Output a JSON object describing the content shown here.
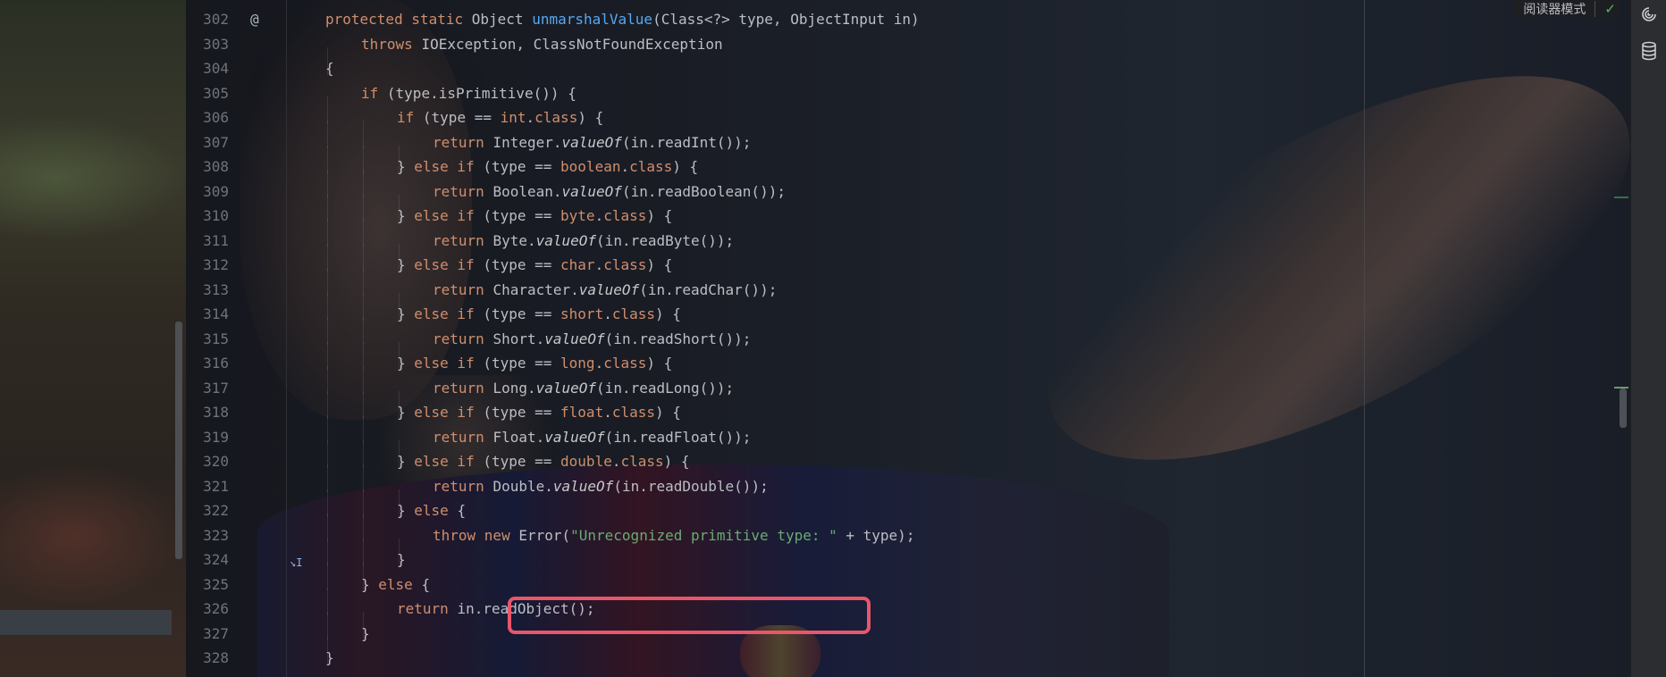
{
  "reader_mode_label": "阅读器模式",
  "colors": {
    "keyword": "#cf8e6d",
    "method": "#56a8f5",
    "string": "#6aab73",
    "highlight": "#e8566a",
    "check": "#5fb865"
  },
  "lines": [
    {
      "num": "302",
      "indent": 0,
      "mark": "@",
      "tokens": [
        {
          "t": "protected ",
          "c": "kw"
        },
        {
          "t": "static ",
          "c": "kw"
        },
        {
          "t": "Object ",
          "c": "pl"
        },
        {
          "t": "unmarshalValue",
          "c": "fn"
        },
        {
          "t": "(Class<?> type, ObjectInput in)",
          "c": "pl"
        }
      ]
    },
    {
      "num": "303",
      "indent": 1,
      "tokens": [
        {
          "t": "throws ",
          "c": "kw"
        },
        {
          "t": "IOException, ClassNotFoundException",
          "c": "pl"
        }
      ]
    },
    {
      "num": "304",
      "indent": 0,
      "tokens": [
        {
          "t": "{",
          "c": "pl"
        }
      ]
    },
    {
      "num": "305",
      "indent": 1,
      "tokens": [
        {
          "t": "if ",
          "c": "kw"
        },
        {
          "t": "(type.isPrimitive()) {",
          "c": "pl"
        }
      ]
    },
    {
      "num": "306",
      "indent": 2,
      "tokens": [
        {
          "t": "if ",
          "c": "kw"
        },
        {
          "t": "(type == ",
          "c": "pl"
        },
        {
          "t": "int",
          "c": "kw"
        },
        {
          "t": ".",
          "c": "pl"
        },
        {
          "t": "class",
          "c": "kw"
        },
        {
          "t": ") {",
          "c": "pl"
        }
      ]
    },
    {
      "num": "307",
      "indent": 3,
      "tokens": [
        {
          "t": "return ",
          "c": "kw"
        },
        {
          "t": "Integer.",
          "c": "pl"
        },
        {
          "t": "valueOf",
          "c": "it"
        },
        {
          "t": "(in.readInt());",
          "c": "pl"
        }
      ]
    },
    {
      "num": "308",
      "indent": 2,
      "tokens": [
        {
          "t": "} ",
          "c": "pl"
        },
        {
          "t": "else if ",
          "c": "kw"
        },
        {
          "t": "(type == ",
          "c": "pl"
        },
        {
          "t": "boolean",
          "c": "kw"
        },
        {
          "t": ".",
          "c": "pl"
        },
        {
          "t": "class",
          "c": "kw"
        },
        {
          "t": ") {",
          "c": "pl"
        }
      ]
    },
    {
      "num": "309",
      "indent": 3,
      "tokens": [
        {
          "t": "return ",
          "c": "kw"
        },
        {
          "t": "Boolean.",
          "c": "pl"
        },
        {
          "t": "valueOf",
          "c": "it"
        },
        {
          "t": "(in.readBoolean());",
          "c": "pl"
        }
      ]
    },
    {
      "num": "310",
      "indent": 2,
      "tokens": [
        {
          "t": "} ",
          "c": "pl"
        },
        {
          "t": "else if ",
          "c": "kw"
        },
        {
          "t": "(type == ",
          "c": "pl"
        },
        {
          "t": "byte",
          "c": "kw"
        },
        {
          "t": ".",
          "c": "pl"
        },
        {
          "t": "class",
          "c": "kw"
        },
        {
          "t": ") {",
          "c": "pl"
        }
      ]
    },
    {
      "num": "311",
      "indent": 3,
      "tokens": [
        {
          "t": "return ",
          "c": "kw"
        },
        {
          "t": "Byte.",
          "c": "pl"
        },
        {
          "t": "valueOf",
          "c": "it"
        },
        {
          "t": "(in.readByte());",
          "c": "pl"
        }
      ]
    },
    {
      "num": "312",
      "indent": 2,
      "tokens": [
        {
          "t": "} ",
          "c": "pl"
        },
        {
          "t": "else if ",
          "c": "kw"
        },
        {
          "t": "(type == ",
          "c": "pl"
        },
        {
          "t": "char",
          "c": "kw"
        },
        {
          "t": ".",
          "c": "pl"
        },
        {
          "t": "class",
          "c": "kw"
        },
        {
          "t": ") {",
          "c": "pl"
        }
      ]
    },
    {
      "num": "313",
      "indent": 3,
      "tokens": [
        {
          "t": "return ",
          "c": "kw"
        },
        {
          "t": "Character.",
          "c": "pl"
        },
        {
          "t": "valueOf",
          "c": "it"
        },
        {
          "t": "(in.readChar());",
          "c": "pl"
        }
      ]
    },
    {
      "num": "314",
      "indent": 2,
      "tokens": [
        {
          "t": "} ",
          "c": "pl"
        },
        {
          "t": "else if ",
          "c": "kw"
        },
        {
          "t": "(type == ",
          "c": "pl"
        },
        {
          "t": "short",
          "c": "kw"
        },
        {
          "t": ".",
          "c": "pl"
        },
        {
          "t": "class",
          "c": "kw"
        },
        {
          "t": ") {",
          "c": "pl"
        }
      ]
    },
    {
      "num": "315",
      "indent": 3,
      "tokens": [
        {
          "t": "return ",
          "c": "kw"
        },
        {
          "t": "Short.",
          "c": "pl"
        },
        {
          "t": "valueOf",
          "c": "it"
        },
        {
          "t": "(in.readShort());",
          "c": "pl"
        }
      ]
    },
    {
      "num": "316",
      "indent": 2,
      "tokens": [
        {
          "t": "} ",
          "c": "pl"
        },
        {
          "t": "else if ",
          "c": "kw"
        },
        {
          "t": "(type == ",
          "c": "pl"
        },
        {
          "t": "long",
          "c": "kw"
        },
        {
          "t": ".",
          "c": "pl"
        },
        {
          "t": "class",
          "c": "kw"
        },
        {
          "t": ") {",
          "c": "pl"
        }
      ]
    },
    {
      "num": "317",
      "indent": 3,
      "tokens": [
        {
          "t": "return ",
          "c": "kw"
        },
        {
          "t": "Long.",
          "c": "pl"
        },
        {
          "t": "valueOf",
          "c": "it"
        },
        {
          "t": "(in.readLong());",
          "c": "pl"
        }
      ]
    },
    {
      "num": "318",
      "indent": 2,
      "tokens": [
        {
          "t": "} ",
          "c": "pl"
        },
        {
          "t": "else if ",
          "c": "kw"
        },
        {
          "t": "(type == ",
          "c": "pl"
        },
        {
          "t": "float",
          "c": "kw"
        },
        {
          "t": ".",
          "c": "pl"
        },
        {
          "t": "class",
          "c": "kw"
        },
        {
          "t": ") {",
          "c": "pl"
        }
      ]
    },
    {
      "num": "319",
      "indent": 3,
      "tokens": [
        {
          "t": "return ",
          "c": "kw"
        },
        {
          "t": "Float.",
          "c": "pl"
        },
        {
          "t": "valueOf",
          "c": "it"
        },
        {
          "t": "(in.readFloat());",
          "c": "pl"
        }
      ]
    },
    {
      "num": "320",
      "indent": 2,
      "tokens": [
        {
          "t": "} ",
          "c": "pl"
        },
        {
          "t": "else if ",
          "c": "kw"
        },
        {
          "t": "(type == ",
          "c": "pl"
        },
        {
          "t": "double",
          "c": "kw"
        },
        {
          "t": ".",
          "c": "pl"
        },
        {
          "t": "class",
          "c": "kw"
        },
        {
          "t": ") {",
          "c": "pl"
        }
      ]
    },
    {
      "num": "321",
      "indent": 3,
      "tokens": [
        {
          "t": "return ",
          "c": "kw"
        },
        {
          "t": "Double.",
          "c": "pl"
        },
        {
          "t": "valueOf",
          "c": "it"
        },
        {
          "t": "(in.readDouble());",
          "c": "pl"
        }
      ]
    },
    {
      "num": "322",
      "indent": 2,
      "tokens": [
        {
          "t": "} ",
          "c": "pl"
        },
        {
          "t": "else ",
          "c": "kw"
        },
        {
          "t": "{",
          "c": "pl"
        }
      ]
    },
    {
      "num": "323",
      "indent": 3,
      "tokens": [
        {
          "t": "throw ",
          "c": "kw"
        },
        {
          "t": "new ",
          "c": "kw"
        },
        {
          "t": "Error(",
          "c": "pl"
        },
        {
          "t": "\"Unrecognized primitive type: \"",
          "c": "str"
        },
        {
          "t": " + type);",
          "c": "pl"
        }
      ]
    },
    {
      "num": "324",
      "indent": 2,
      "arrow": true,
      "tokens": [
        {
          "t": "}",
          "c": "pl"
        }
      ]
    },
    {
      "num": "325",
      "indent": 1,
      "tokens": [
        {
          "t": "} ",
          "c": "pl"
        },
        {
          "t": "else ",
          "c": "kw"
        },
        {
          "t": "{",
          "c": "pl"
        }
      ]
    },
    {
      "num": "326",
      "indent": 2,
      "tokens": [
        {
          "t": "return ",
          "c": "kw"
        },
        {
          "t": "in.readObject();",
          "c": "pl"
        }
      ]
    },
    {
      "num": "327",
      "indent": 1,
      "tokens": [
        {
          "t": "}",
          "c": "pl"
        }
      ]
    },
    {
      "num": "328",
      "indent": 0,
      "tokens": [
        {
          "t": "}",
          "c": "pl"
        }
      ]
    }
  ]
}
